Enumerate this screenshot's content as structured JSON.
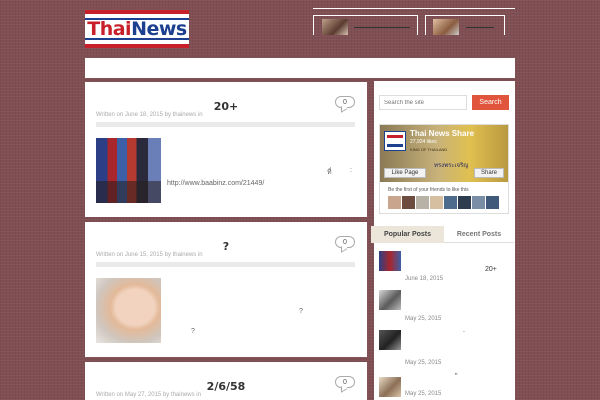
{
  "header": {
    "logo_thai": "Thai",
    "logo_news": "News"
  },
  "posts": [
    {
      "title": "20+",
      "comments": "0",
      "meta": "Written on June 18, 2015 by thainews in",
      "link": "http://www.baabinz.com/21449/",
      "extra": "ที่",
      "extra2": ":"
    },
    {
      "title": "?",
      "comments": "0",
      "meta": "Written on June 15, 2015 by thainews in",
      "extra": "?",
      "extra2": "?"
    },
    {
      "title": "2/6/58",
      "comments": "0",
      "meta": "Written on May 27, 2015 by thainews in"
    }
  ],
  "sidebar": {
    "search_placeholder": "Search the site",
    "search_button": "Search",
    "fb": {
      "page_name": "Thai News Share",
      "likes": "27,924 likes",
      "king": "KING OF THAILAND",
      "thai_text": "ทรงพระเจริญ",
      "like_button": "Like Page",
      "share_button": "Share",
      "friends_text": "Be the first of your friends to like this"
    },
    "tabs": {
      "popular": "Popular Posts",
      "recent": "Recent Posts"
    },
    "popular_posts": [
      {
        "date": "June 18, 2015",
        "text": "20+"
      },
      {
        "date": "May 25, 2015",
        "text": ""
      },
      {
        "date": "May 25, 2015",
        "text": "."
      },
      {
        "date": "May 25, 2015",
        "text": "\""
      }
    ]
  }
}
